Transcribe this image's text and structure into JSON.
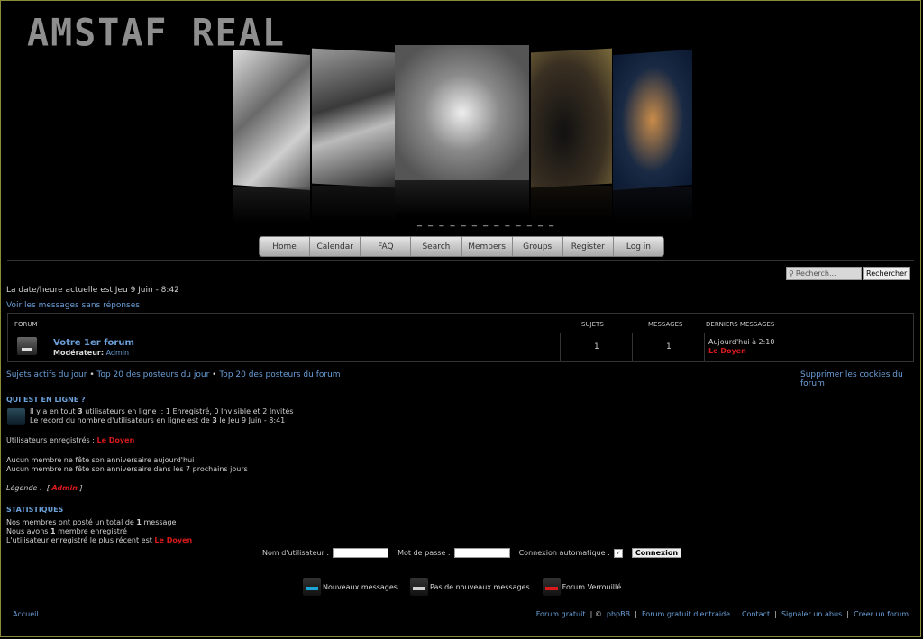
{
  "site": {
    "logo": "AMSTAF REAL",
    "dashes": "_ _ _ _ _ _ _ _ _ _ _ _ _"
  },
  "nav": [
    "Home",
    "Calendar",
    "FAQ",
    "Search",
    "Members",
    "Groups",
    "Register",
    "Log in"
  ],
  "search": {
    "placeholder": "Recherch...",
    "button": "Rechercher"
  },
  "datetime": "La date/heure actuelle est Jeu 9 Juin - 8:42",
  "unanswered_link": "Voir les messages sans réponses",
  "table": {
    "headers": {
      "forum": "FORUM",
      "topics": "SUJETS",
      "messages": "MESSAGES",
      "last": "DERNIERS MESSAGES"
    },
    "row": {
      "title": "Votre 1er forum",
      "mod_label": "Modérateur:",
      "mod_name": "Admin",
      "topics": "1",
      "messages": "1",
      "last_date": "Aujourd'hui à 2:10",
      "last_user": "Le Doyen"
    }
  },
  "links_row": {
    "active": "Sujets actifs du jour",
    "top20_day": "Top 20 des posteurs du jour",
    "top20_forum": "Top 20 des posteurs du forum",
    "cookies": "Supprimer les cookies du forum",
    "sep": "•"
  },
  "online": {
    "title": "QUI EST EN LIGNE ?",
    "line1_a": "Il y a en tout ",
    "line1_b": "3",
    "line1_c": " utilisateurs en ligne :: 1 Enregistré, 0 Invisible et 2 Invités",
    "line2_a": "Le record du nombre d'utilisateurs en ligne est de ",
    "line2_b": "3",
    "line2_c": " le Jeu 9 Juin - 8:41",
    "registered_label": "Utilisateurs enregistrés :",
    "registered_user": "Le Doyen",
    "bday1": "Aucun membre ne fête son anniversaire aujourd'hui",
    "bday2": "Aucun membre ne fête son anniversaire dans les 7 prochains jours",
    "legend_label": "Légende :",
    "legend_open": "[",
    "legend_admin": "Admin",
    "legend_close": "]"
  },
  "stats": {
    "title": "STATISTIQUES",
    "l1a": "Nos membres ont posté un total de ",
    "l1b": "1",
    "l1c": " message",
    "l2a": "Nous avons ",
    "l2b": "1",
    "l2c": " membre enregistré",
    "l3a": "L'utilisateur enregistré le plus récent est ",
    "l3b": "Le Doyen"
  },
  "login": {
    "user_label": "Nom d'utilisateur :",
    "pass_label": "Mot de passe :",
    "auto_label": "Connexion automatique :",
    "button": "Connexion"
  },
  "legend_icons": [
    {
      "label": "Nouveaux messages",
      "color": "#1aa6d8"
    },
    {
      "label": "Pas de nouveaux messages",
      "color": "#cfcfcf"
    },
    {
      "label": "Forum Verrouillé",
      "color": "#d81a1a"
    }
  ],
  "footer": {
    "home": "Accueil",
    "items": [
      "Forum gratuit",
      "©",
      "phpBB",
      "Forum gratuit d'entraide",
      "Contact",
      "Signaler un abus",
      "Créer un forum"
    ],
    "sep": "|"
  }
}
